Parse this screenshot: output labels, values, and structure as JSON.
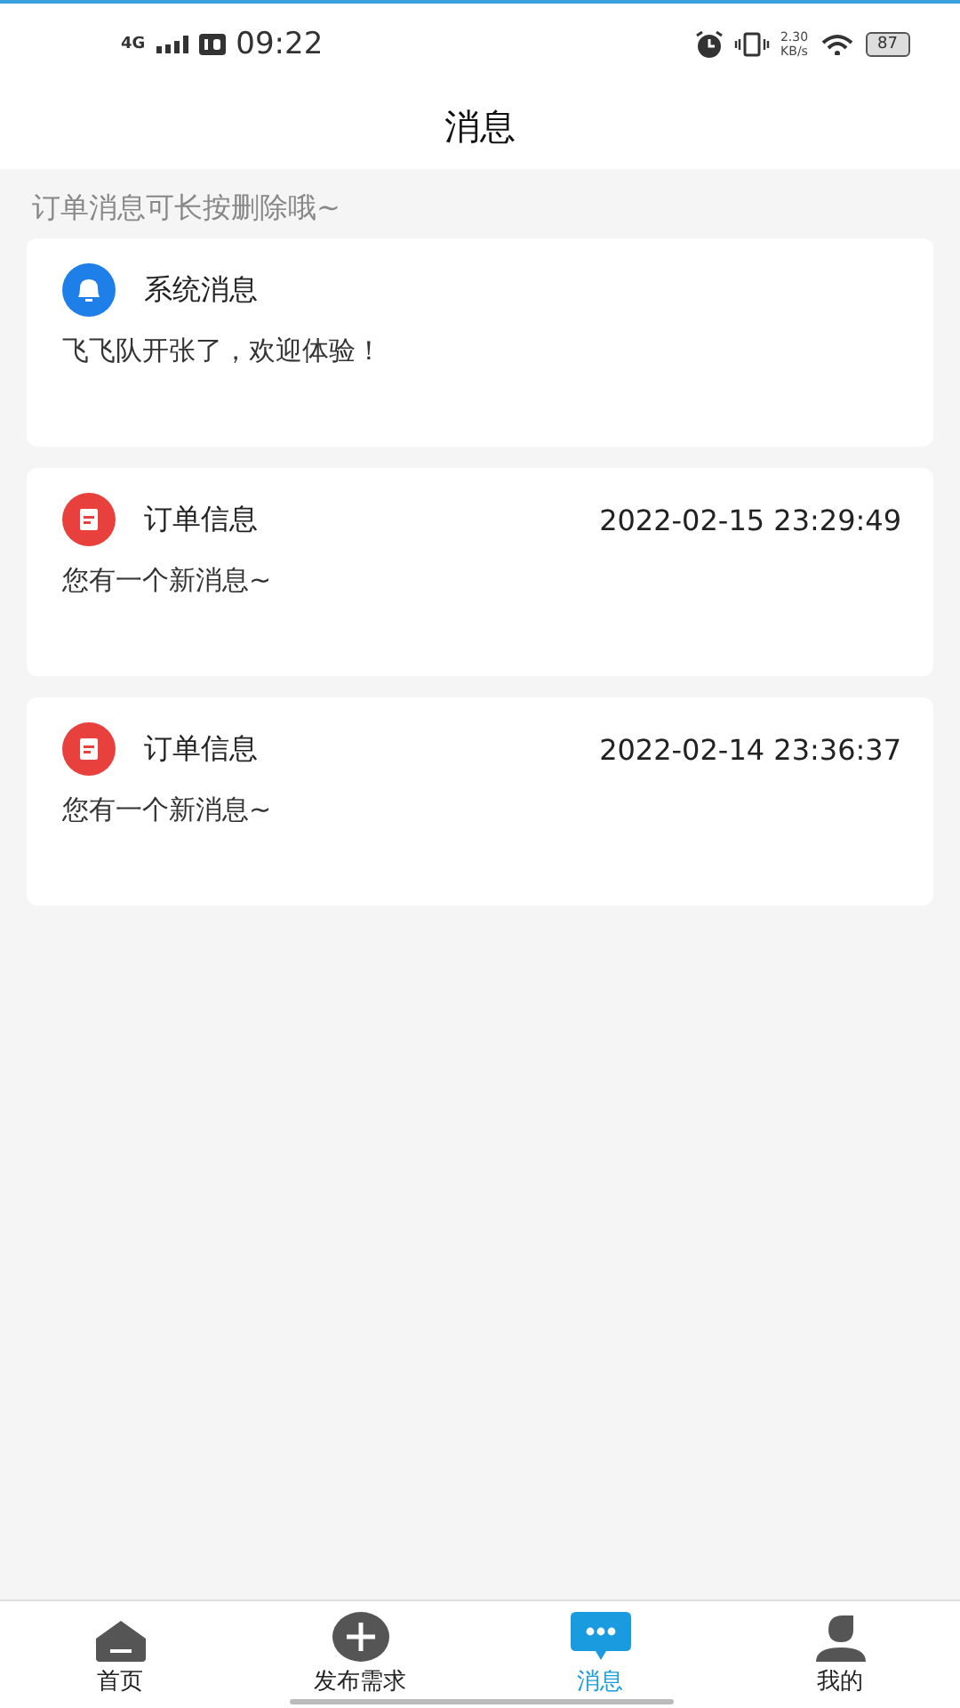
{
  "status_bar": {
    "network": "4G",
    "time": "09:22",
    "speed_value": "2.30",
    "speed_unit": "KB/s",
    "battery": "87"
  },
  "header": {
    "title": "消息"
  },
  "hint": "订单消息可长按删除哦~",
  "messages": [
    {
      "kind": "system",
      "title": "系统消息",
      "body": "飞飞队开张了，欢迎体验！"
    },
    {
      "kind": "order",
      "title": "订单信息",
      "time": "2022-02-15 23:29:49",
      "body": "您有一个新消息~"
    },
    {
      "kind": "order",
      "title": "订单信息",
      "time": "2022-02-14 23:36:37",
      "body": "您有一个新消息~"
    }
  ],
  "tab_bar": [
    {
      "kind": "home",
      "label": "首页",
      "selected": false
    },
    {
      "kind": "publish",
      "label": "发布需求",
      "selected": false
    },
    {
      "kind": "messages",
      "label": "消息",
      "selected": true
    },
    {
      "kind": "profile",
      "label": "我的",
      "selected": false
    }
  ]
}
